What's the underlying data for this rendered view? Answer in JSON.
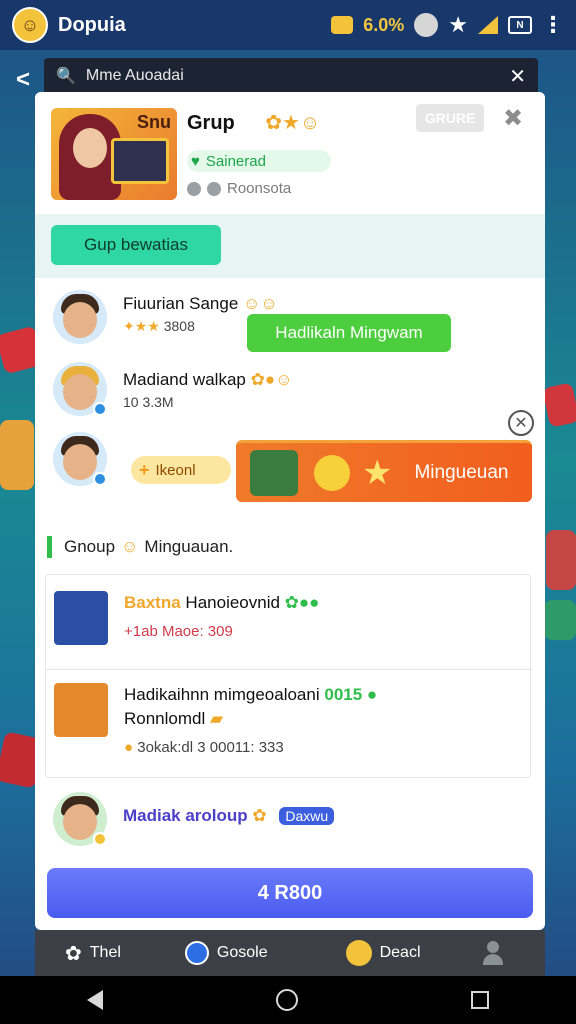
{
  "status_bar": {
    "app_name": "Dopuia",
    "percent": "6.0%",
    "icons": [
      "coin-icon",
      "face-icon",
      "star-icon",
      "signal-icon",
      "nfc-icon",
      "more-icon"
    ]
  },
  "search": {
    "value": "Mme Auoadai"
  },
  "profile": {
    "image_label": "Snu",
    "name": "Grup",
    "status": "Sainerad",
    "sub": "Roonsota",
    "gray_button": "GRURE"
  },
  "group_button": "Gup bewatias",
  "members": [
    {
      "name": "Fiuurian Sange",
      "sub": "3808"
    },
    {
      "name": "Madiand walkap",
      "sub": "10 3.3M"
    },
    {
      "pill": "Ikeonl"
    }
  ],
  "green_pill": "Hadlikaln Mingwam",
  "orange_button": "Mingueuan",
  "section": {
    "label1": "Gnoup",
    "label2": "Minguauan."
  },
  "groups": [
    {
      "title_prefix": "Baxtna",
      "title": "Hanoieovnid",
      "sub": "+1ab Maoe: 309"
    },
    {
      "title": "Hadikaihnn mimgeoaloani",
      "title_suffix": "0015",
      "line2": "Ronnlomdl",
      "sub": "3okak:dl 3 00011: 333"
    }
  ],
  "last_row": {
    "name": "Madiak aroloup",
    "badge": "Daxwu"
  },
  "primary_button": "4 R800",
  "tabs": [
    {
      "label": "Thel",
      "icon": "flower-icon"
    },
    {
      "label": "Gosole",
      "icon": "chat-icon"
    },
    {
      "label": "Deacl",
      "icon": "smile-icon"
    },
    {
      "label": "",
      "icon": "person-icon"
    }
  ],
  "colors": {
    "accent_green": "#4cce3e",
    "accent_orange": "#f15e1e",
    "primary_blue": "#4a5cf0",
    "teal": "#2fd7a4"
  }
}
